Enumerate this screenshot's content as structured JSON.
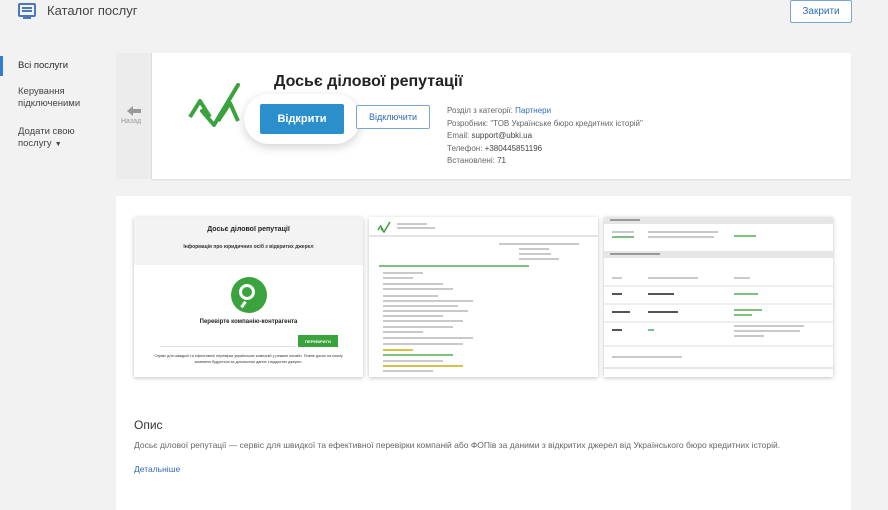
{
  "header": {
    "app_icon": "monitor-icon",
    "title": "Каталог послуг",
    "close_label": "Закрити"
  },
  "sidebar": {
    "items": [
      {
        "label": "Всі послуги"
      },
      {
        "label": "Керування підключеними"
      },
      {
        "label": "Додати свою послугу"
      }
    ]
  },
  "back": {
    "icon": "arrow-left-icon",
    "label": "Назад"
  },
  "service": {
    "title": "Досьє ділової репутації",
    "open_label": "Відкрити",
    "disconnect_label": "Відключити",
    "category_prefix": "Розділ з категорії:",
    "category": "Партнери",
    "developer_prefix": "Розробник:",
    "developer": "\"ТОВ Українське бюро кредитних історій\"",
    "email_prefix": "Email:",
    "email": "support@ubki.ua",
    "phone_prefix": "Телефон:",
    "phone": "+380445851196",
    "installs_prefix": "Встановлені:",
    "installs": "71",
    "accent_color": "#2b8fcc",
    "logo_color": "#3ba33d"
  },
  "screenshots": {
    "s1": {
      "title": "Досьє ділової репутації",
      "subtitle": "Інформація про юридичних осіб з відкритих джерел",
      "check_text": "Перевірте компанію-контрагента",
      "button": "ПЕРЕВІРИТИ",
      "description": "Сервіс для швидкої та ефективної перевірки українських компаній у режимі онлайн. Повне досьє на кожну компанію будується за допомогою даних з відкритих джерел."
    }
  },
  "description": {
    "heading": "Опис",
    "text": "Досьє ділової репутації — сервіс для швидкої та ефективної перевірки компаній або ФОПів за даними з відкритих джерел від Українського бюро кредитних історій.",
    "more_label": "Детальніше"
  }
}
